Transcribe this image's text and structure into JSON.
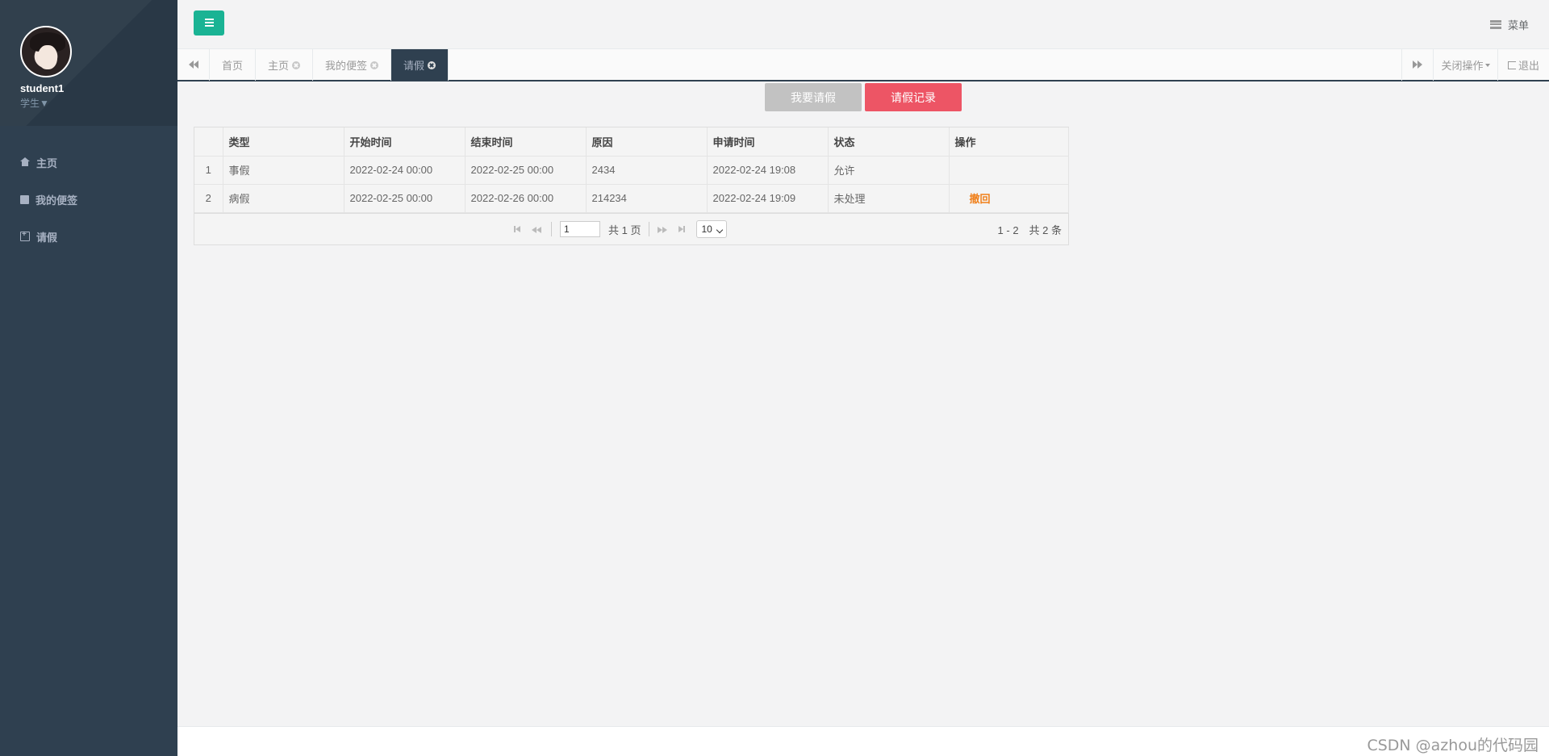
{
  "user": {
    "name": "student1",
    "role": "学生▼"
  },
  "sidebar": {
    "items": [
      {
        "label": "主页",
        "icon": "home-icon"
      },
      {
        "label": "我的便签",
        "icon": "note-icon"
      },
      {
        "label": "请假",
        "icon": "calendar-icon"
      }
    ]
  },
  "topbar": {
    "menu_label": "菜单"
  },
  "tabs": {
    "items": [
      {
        "label": "首页"
      },
      {
        "label": "主页"
      },
      {
        "label": "我的便签"
      },
      {
        "label": "请假"
      }
    ],
    "close_ops_label": "关闭操作",
    "logout_label": "退出"
  },
  "actions": {
    "apply_label": "我要请假",
    "records_label": "请假记录"
  },
  "table": {
    "columns": [
      "",
      "类型",
      "开始时间",
      "结束时间",
      "原因",
      "申请时间",
      "状态",
      "操作"
    ],
    "rows": [
      {
        "idx": "1",
        "type": "事假",
        "start": "2022-02-24 00:00",
        "end": "2022-02-25 00:00",
        "reason": "2434",
        "applied": "2022-02-24 19:08",
        "status": "允许",
        "action": ""
      },
      {
        "idx": "2",
        "type": "病假",
        "start": "2022-02-25 00:00",
        "end": "2022-02-26 00:00",
        "reason": "214234",
        "applied": "2022-02-24 19:09",
        "status": "未处理",
        "action": "撤回"
      }
    ]
  },
  "pager": {
    "page_value": "1",
    "total_pages_label": "共 1 页",
    "page_size": "10",
    "info": "1 - 2　共 2 条"
  },
  "watermark": "CSDN @azhou的代码园",
  "colors": {
    "sidebar": "#2f4050",
    "accent": "#1ab394",
    "danger": "#ed5565",
    "warning_text": "#f0801b"
  }
}
